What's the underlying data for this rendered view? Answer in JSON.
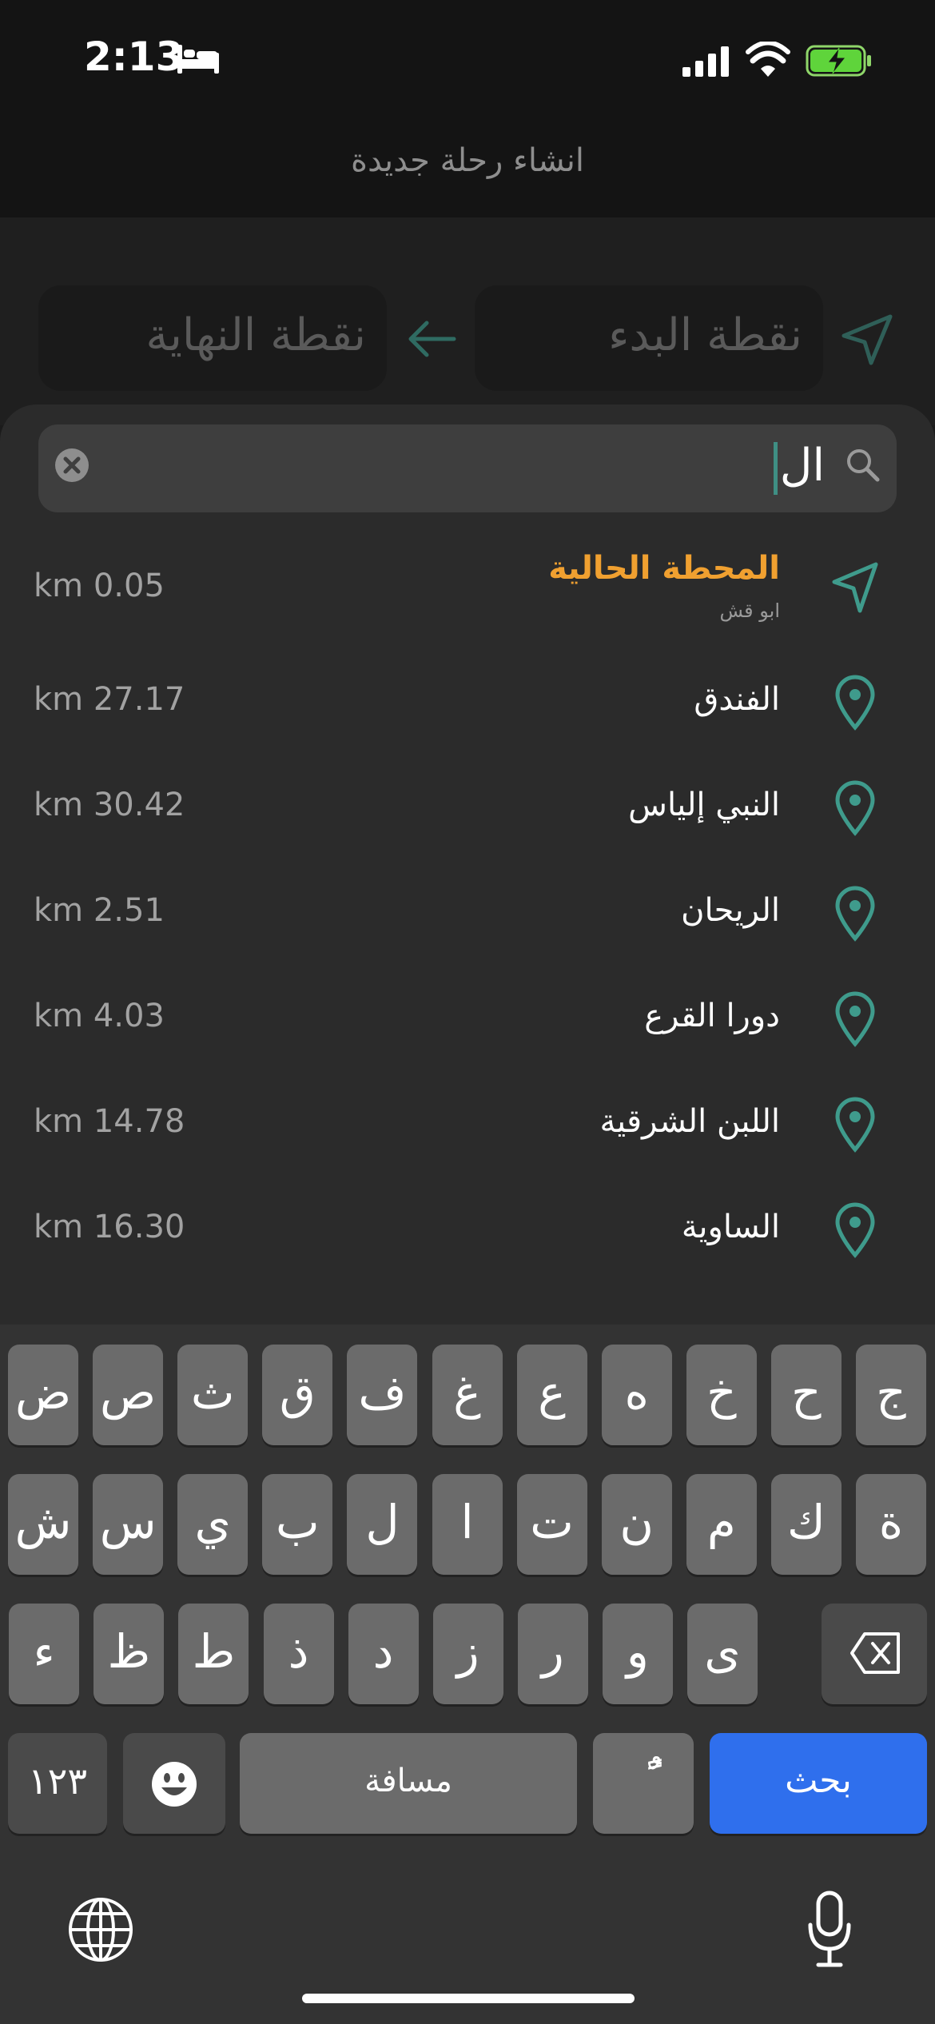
{
  "status_bar": {
    "time": "2:13"
  },
  "header": {
    "title": "انشاء رحلة جديدة"
  },
  "route": {
    "start_label": "نقطة البدء",
    "end_label": "نقطة النهاية"
  },
  "search": {
    "query": "ال"
  },
  "results": [
    {
      "name": "المحطة الحالية",
      "subtitle": "ابو قش",
      "distance": "km 0.05",
      "icon": "navigation-arrow-icon"
    },
    {
      "name": "الفندق",
      "distance": "km 27.17",
      "icon": "map-pin-icon"
    },
    {
      "name": "النبي إلياس",
      "distance": "km 30.42",
      "icon": "map-pin-icon"
    },
    {
      "name": "الريحان",
      "distance": "km 2.51",
      "icon": "map-pin-icon"
    },
    {
      "name": "دورا القرع",
      "distance": "km 4.03",
      "icon": "map-pin-icon"
    },
    {
      "name": "اللبن الشرقية",
      "distance": "km 14.78",
      "icon": "map-pin-icon"
    },
    {
      "name": "الساوية",
      "distance": "km 16.30",
      "icon": "map-pin-icon"
    }
  ],
  "keyboard": {
    "row1": [
      "ج",
      "ح",
      "خ",
      "ه",
      "ع",
      "غ",
      "ف",
      "ق",
      "ث",
      "ص",
      "ض"
    ],
    "row2": [
      "ة",
      "ك",
      "م",
      "ن",
      "ت",
      "ا",
      "ل",
      "ب",
      "ي",
      "س",
      "ش"
    ],
    "row3": [
      "ى",
      "و",
      "ر",
      "ز",
      "د",
      "ذ",
      "ط",
      "ظ",
      "ء"
    ],
    "numbers_key": "١٢٣",
    "space_key": "مسافة",
    "diacritic_key": "ًٌ",
    "search_key": "بحث"
  },
  "colors": {
    "accent_teal": "#3f9b8c",
    "current_orange": "#f0a030",
    "key_blue": "#2f6fed"
  }
}
